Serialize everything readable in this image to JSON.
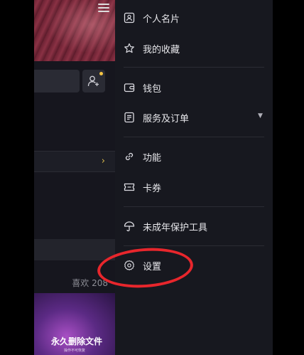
{
  "background_app": {
    "likes_label": "喜欢 208",
    "thumbnail_title": "永久删除文件",
    "thumbnail_subtitle": "操作不可恢复",
    "row_chevron": "›"
  },
  "drawer": {
    "items": [
      {
        "label": "个人名片",
        "icon": "id-card-icon"
      },
      {
        "label": "我的收藏",
        "icon": "star-icon"
      },
      {
        "label": "钱包",
        "icon": "wallet-icon"
      },
      {
        "label": "服务及订单",
        "icon": "document-list-icon",
        "has_dropdown": true,
        "caret": "▼"
      },
      {
        "label": "功能",
        "icon": "link-icon"
      },
      {
        "label": "卡券",
        "icon": "ticket-icon"
      },
      {
        "label": "未成年保护工具",
        "icon": "umbrella-icon"
      },
      {
        "label": "设置",
        "icon": "gear-icon",
        "highlighted": true
      }
    ]
  },
  "colors": {
    "drawer_bg": "#17181f",
    "text": "#e8e8ec",
    "highlight_ring": "#e8262c",
    "accent_dot": "#f5c443"
  }
}
